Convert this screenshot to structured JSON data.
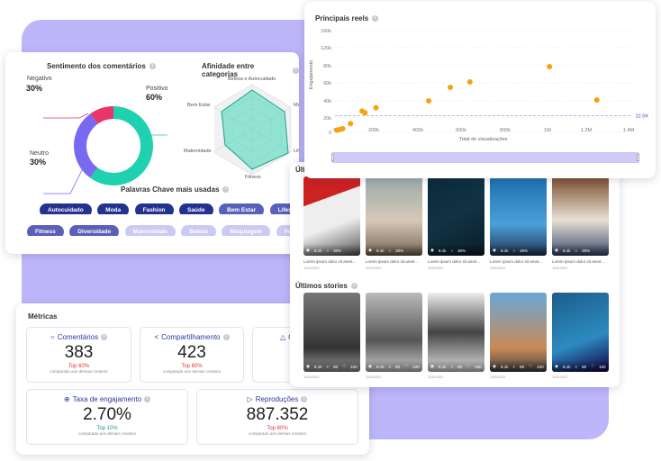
{
  "sentiment": {
    "title": "Sentimento dos comentários",
    "negative_label": "Negativo",
    "negative_pct": "30%",
    "positive_label": "Positivo",
    "positive_pct": "60%",
    "neutral_label": "Neutro",
    "neutral_pct": "30%",
    "colors": {
      "negative": "#e8366a",
      "positive": "#1fd1ae",
      "neutral": "#7968f0"
    }
  },
  "affinity": {
    "title": "Afinidade entre categorias",
    "axes": [
      "Beleza e Autocuidado",
      "Moda",
      "Lifestyle",
      "Fitness",
      "Maternidade",
      "Bem Estar"
    ]
  },
  "keywords": {
    "title": "Palavras Chave mais usadas",
    "row1": [
      "Autocuidado",
      "Moda",
      "Fashion",
      "Saúde",
      "Bem Estar",
      "Lifestyle"
    ],
    "row2": [
      "Fitness",
      "Diversidade",
      "Maternidade",
      "Beleza",
      "Maquiagem",
      "Pentea"
    ]
  },
  "chart_data": {
    "type": "scatter",
    "title": "Principais reels",
    "xlabel": "Total de visualizações",
    "ylabel": "Engajamento",
    "xlim": [
      0,
      1400000
    ],
    "ylim": [
      0,
      160000
    ],
    "x_ticks": [
      "0",
      "200k",
      "400k",
      "600k",
      "800k",
      "1M",
      "1.2M",
      "1.4M"
    ],
    "y_ticks": [
      "0",
      "20k",
      "40k",
      "60k",
      "80k",
      "120k",
      "160k"
    ],
    "reference_line": {
      "value": 22500,
      "label": "22.5K"
    },
    "point_color": "#f5a40c",
    "points": [
      [
        10000,
        3000
      ],
      [
        25000,
        4000
      ],
      [
        40000,
        5000
      ],
      [
        80000,
        12000
      ],
      [
        140000,
        28000
      ],
      [
        155000,
        26000
      ],
      [
        210000,
        32000
      ],
      [
        450000,
        40000
      ],
      [
        550000,
        55000
      ],
      [
        640000,
        61000
      ],
      [
        1010000,
        79000
      ],
      [
        1250000,
        41000
      ]
    ]
  },
  "feed": {
    "reels_title": "Últ",
    "stories_title": "Últimos stories",
    "reel_items": [
      {
        "views": "8.1k",
        "comments": "30%",
        "caption": "Lorem ipsum dolor sit amet...",
        "date": "11/5/2022"
      },
      {
        "views": "8.1k",
        "comments": "30%",
        "caption": "Lorem ipsum dolor sit amet...",
        "date": "11/5/2022"
      },
      {
        "views": "8.1k",
        "comments": "30%",
        "caption": "Lorem ipsum dolor sit amet...",
        "date": "11/5/2022"
      },
      {
        "views": "8.1k",
        "comments": "30%",
        "caption": "Lorem ipsum dolor sit amet...",
        "date": "11/5/2022"
      },
      {
        "views": "8.1k",
        "comments": "30%",
        "caption": "Lorem ipsum dolor sit amet...",
        "date": "11/5/2022"
      }
    ],
    "story_items": [
      {
        "views": "8.1k",
        "shares": "80",
        "likes": "100",
        "date": "11/5/2022"
      },
      {
        "views": "8.1k",
        "shares": "80",
        "likes": "100",
        "date": "11/5/2022"
      },
      {
        "views": "8.1k",
        "shares": "80",
        "likes": "100",
        "date": "11/5/2022"
      },
      {
        "views": "8.1k",
        "shares": "80",
        "likes": "100",
        "date": "11/5/2022"
      },
      {
        "views": "8.1k",
        "shares": "80",
        "likes": "100",
        "date": "11/5/2022"
      }
    ]
  },
  "metrics": {
    "title": "Métricas",
    "comments": {
      "label": "Comentários",
      "value": "383",
      "top": "Top 60%",
      "compare": "comparado aos demais creators"
    },
    "shares": {
      "label": "Compartilhamento",
      "value": "423",
      "top": "Top 60%",
      "compare": "comparado aos demais creators"
    },
    "likes_partial": "C",
    "engagement": {
      "label": "Taxa de engajamento",
      "value": "2.70%",
      "top": "Top 10%",
      "compare": "comparado aos demais creators"
    },
    "plays": {
      "label": "Reproduções",
      "value": "887.352",
      "top": "Top 60%",
      "compare": "comparado aos demais creators"
    }
  }
}
